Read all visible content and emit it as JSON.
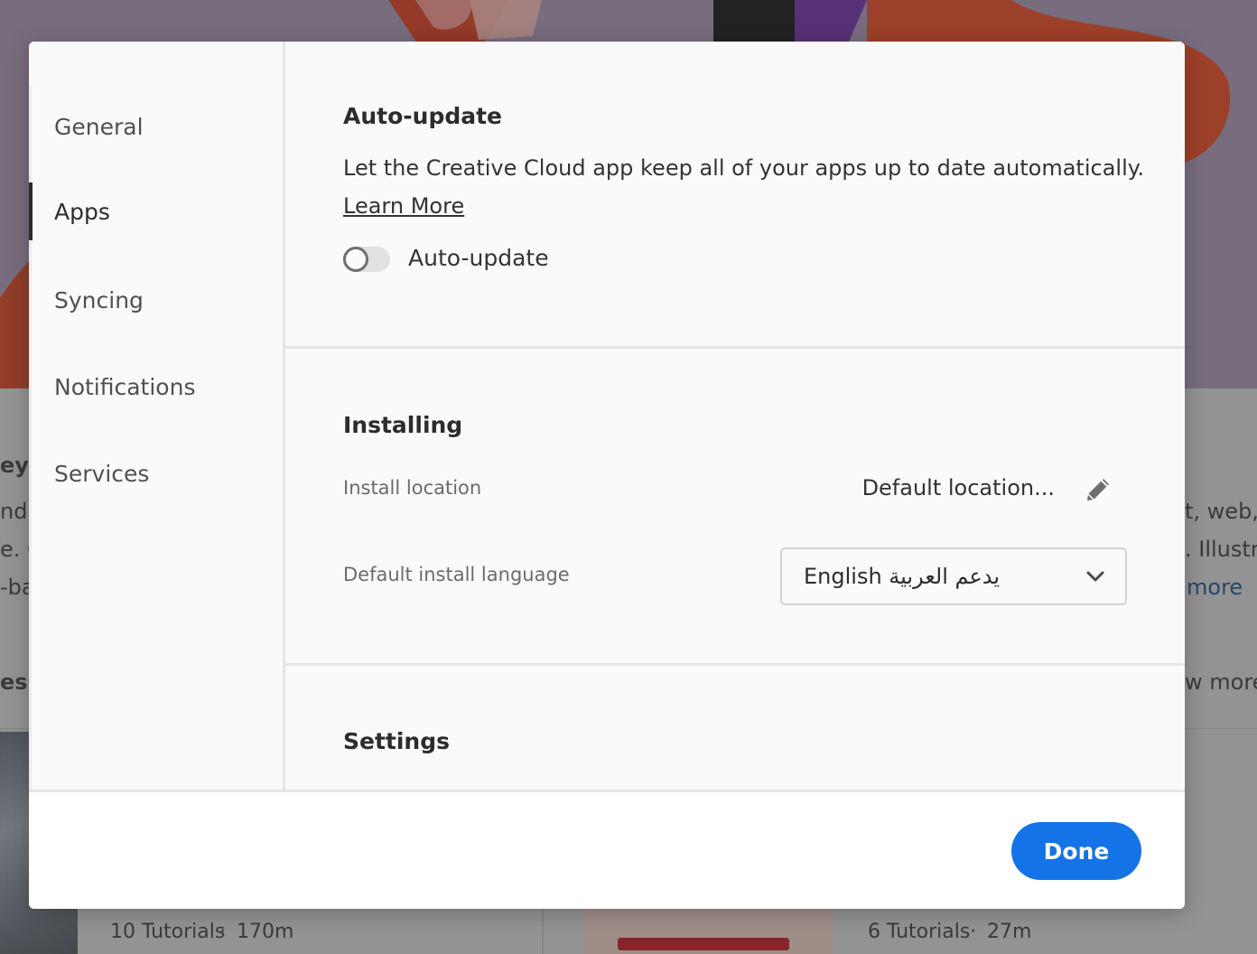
{
  "background": {
    "partial_texts": {
      "left_heading": "ey f",
      "left_line_1": "ndu",
      "left_line_2": "e. G",
      "left_line_3": "-ba",
      "left_section": "es",
      "right_line_1": "t, web,",
      "right_line_2": ". Illustra",
      "right_link": "more",
      "right_section": "w more"
    },
    "cards": [
      {
        "tutorials": "10 Tutorials",
        "duration": "170m"
      },
      {
        "tutorials": "6 Tutorials",
        "duration": "27m"
      }
    ],
    "dot": "·"
  },
  "sidebar": {
    "items": [
      {
        "label": "General"
      },
      {
        "label": "Apps"
      },
      {
        "label": "Syncing"
      },
      {
        "label": "Notifications"
      },
      {
        "label": "Services"
      }
    ],
    "active_item": "Apps"
  },
  "auto_update": {
    "title": "Auto-update",
    "description": "Let the Creative Cloud app keep all of your apps up to date automatically.",
    "learn_more": "Learn More",
    "toggle_label": "Auto-update",
    "toggle_on": false
  },
  "installing": {
    "title": "Installing",
    "location_label": "Install location",
    "location_value": "Default location...",
    "language_label": "Default install language",
    "language_value": "English يدعم العربية"
  },
  "settings": {
    "title": "Settings"
  },
  "footer": {
    "done_label": "Done"
  },
  "colors": {
    "accent": "#1473e6",
    "active_indicator": "#2c2c2c"
  },
  "icons": {
    "edit": "pencil-icon",
    "dropdown": "chevron-down-icon"
  }
}
